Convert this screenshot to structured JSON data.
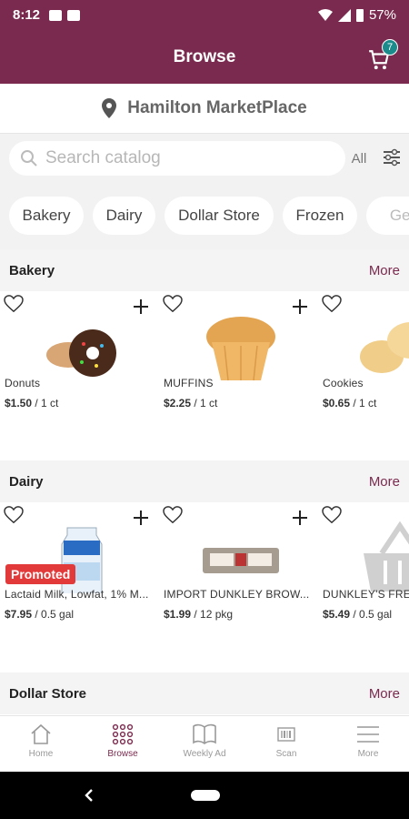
{
  "status": {
    "time": "8:12",
    "battery": "57%"
  },
  "header": {
    "title": "Browse",
    "cart_count": "7"
  },
  "store": {
    "name": "Hamilton MarketPlace"
  },
  "search": {
    "placeholder": "Search catalog",
    "scope": "All"
  },
  "chips": [
    "Bakery",
    "Dairy",
    "Dollar Store",
    "Frozen",
    "Ger"
  ],
  "sections": [
    {
      "title": "Bakery",
      "more": "More",
      "products": [
        {
          "name": "Donuts",
          "price": "$1.50",
          "unit": " / 1 ct"
        },
        {
          "name": "MUFFINS",
          "price": "$2.25",
          "unit": " / 1 ct"
        },
        {
          "name": "Cookies",
          "price": "$0.65",
          "unit": " / 1 ct"
        }
      ]
    },
    {
      "title": "Dairy",
      "more": "More",
      "products": [
        {
          "name": "Lactaid Milk, Lowfat, 1% M...",
          "price": "$7.95",
          "unit": " / 0.5 gal",
          "badge": "Promoted"
        },
        {
          "name": "IMPORT DUNKLEY  BROW...",
          "price": "$1.99",
          "unit": " / 12 pkg"
        },
        {
          "name": "DUNKLEY'S FRESH",
          "price": "$5.49",
          "unit": " / 0.5 gal"
        }
      ]
    },
    {
      "title": "Dollar Store",
      "more": "More"
    }
  ],
  "bottom_nav": [
    {
      "label": "Home",
      "icon": "home-icon"
    },
    {
      "label": "Browse",
      "icon": "grid-icon"
    },
    {
      "label": "Weekly Ad",
      "icon": "book-icon"
    },
    {
      "label": "Scan",
      "icon": "barcode-icon"
    },
    {
      "label": "More",
      "icon": "menu-icon"
    }
  ],
  "colors": {
    "brand": "#7a2a4e",
    "badge": "#1b8b8c",
    "promo": "#e23a3a"
  }
}
